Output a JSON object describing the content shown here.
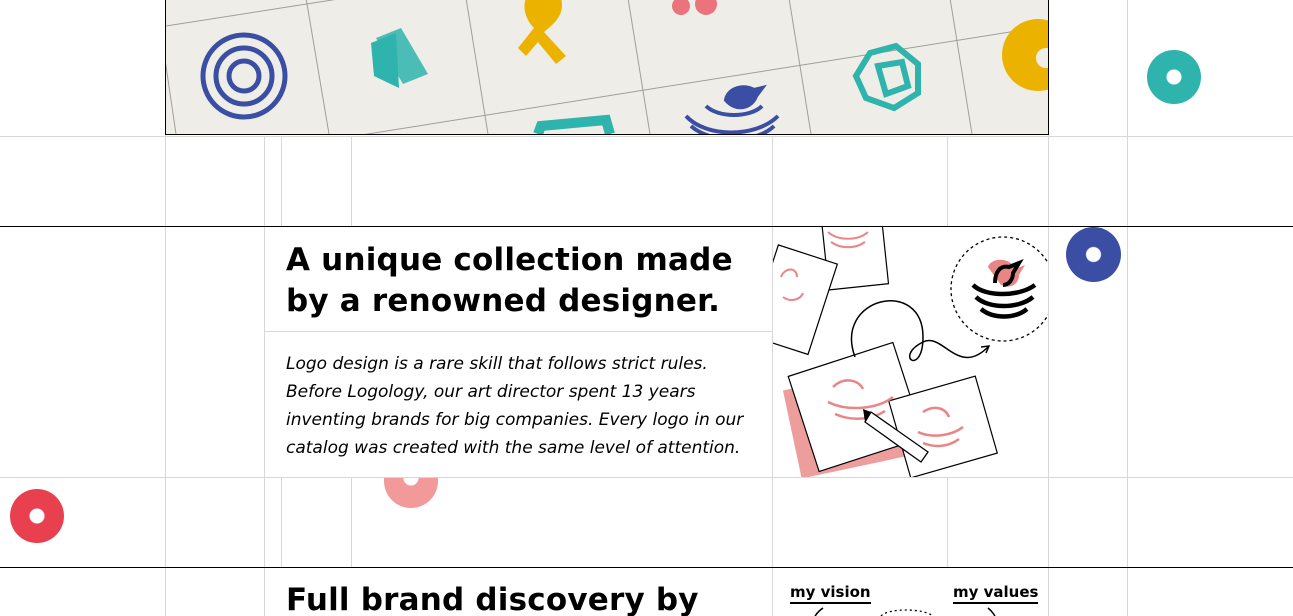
{
  "sections": [
    {
      "heading": "A unique collection made by a renowned designer.",
      "body": "Logo design is a rare skill that follows strict rules. Before Logology, our art director spent 13 years inventing brands for big companies. Every logo in our catalog was created with the same level of attention."
    },
    {
      "heading": "Full brand discovery by"
    }
  ],
  "illustration_labels": {
    "left": "my vision",
    "right": "my values"
  },
  "colors": {
    "teal": "#2fb3ad",
    "navy": "#3a4ea3",
    "red": "#e8404f",
    "pink": "#f29a9a",
    "yellow": "#ecb200",
    "sketch_pink": "#ea8585"
  },
  "icons": [
    "concentric-circle-logo-icon",
    "folded-paper-logo-icon",
    "ribbon-logo-icon",
    "bird-nest-logo-icon",
    "hexagon-logo-icon",
    "pencil-icon",
    "bird-logo-icon"
  ]
}
